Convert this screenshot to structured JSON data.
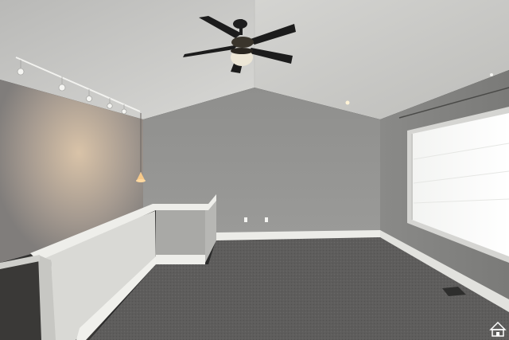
{
  "photo": {
    "subject": "empty-upstairs-room",
    "palette": {
      "ceiling": "#d7d7d4",
      "wall": "#8c8c8a",
      "wall_left_lit": "#c9b8a4",
      "carpet": "#5d5c5b",
      "trim": "#e8e8e4",
      "window": "#f7f8f6",
      "fan_blade": "#1c1c1c"
    }
  }
}
